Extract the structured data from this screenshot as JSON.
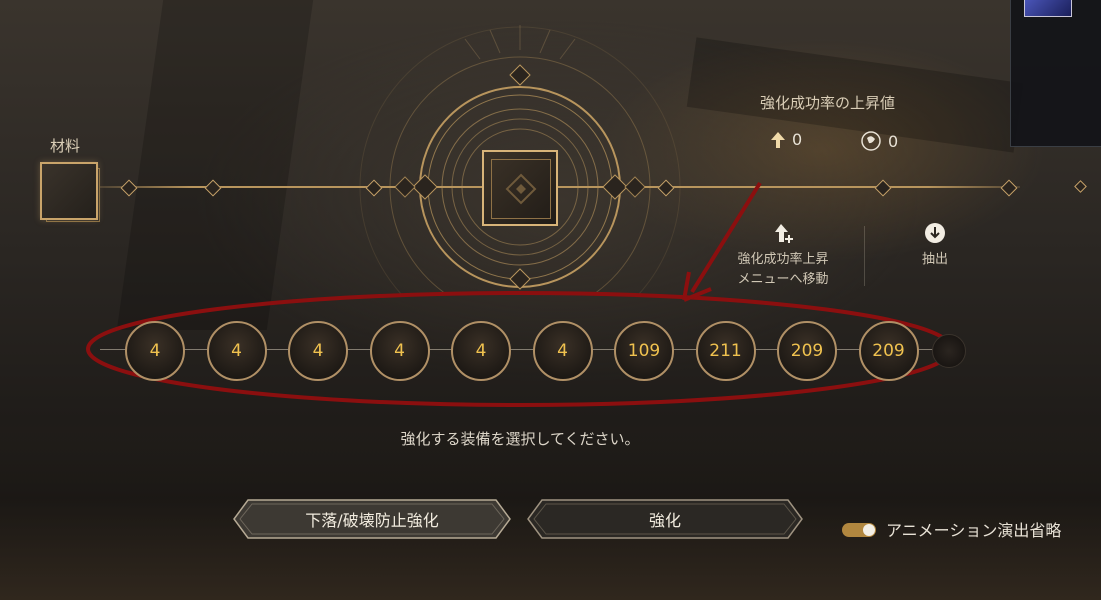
{
  "material": {
    "label": "材料"
  },
  "success_rate": {
    "title": "強化成功率の上昇値",
    "items": [
      {
        "icon": "up-arrow-icon",
        "value": "0"
      },
      {
        "icon": "coin-icon",
        "value": "0"
      }
    ]
  },
  "actions": [
    {
      "label_line1": "強化成功率上昇",
      "label_line2": "メニューへ移動",
      "icon": "rate-up-icon"
    },
    {
      "label_line1": "抽出",
      "label_line2": "",
      "icon": "extract-icon"
    }
  ],
  "enhance_levels": [
    "4",
    "4",
    "4",
    "4",
    "4",
    "4",
    "109",
    "211",
    "209",
    "209"
  ],
  "prompt": "強化する装備を選択してください。",
  "buttons": {
    "protect": "下落/破壊防止強化",
    "enhance": "強化"
  },
  "toggle": {
    "label": "アニメーション演出省略",
    "on": true
  },
  "colors": {
    "gold": "#c9a46a",
    "number": "#f0c24f",
    "annotation": "#8b0f0f"
  }
}
